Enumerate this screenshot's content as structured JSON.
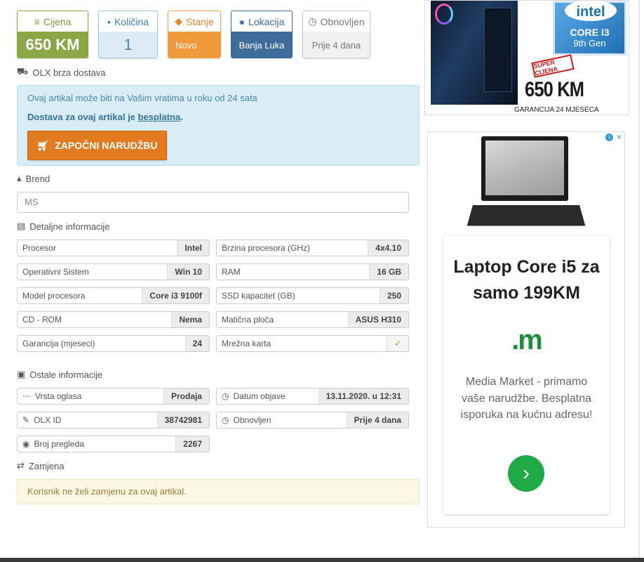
{
  "stats": {
    "price": {
      "label": "Cijena",
      "value": "650 KM"
    },
    "quantity": {
      "label": "Količina",
      "value": "1"
    },
    "condition": {
      "label": "Stanje",
      "value": "Novo"
    },
    "location": {
      "label": "Lokacija",
      "value": "Banja Luka"
    },
    "updated": {
      "label": "Obnovljen",
      "value": "Prije 4 dana"
    }
  },
  "delivery": {
    "title": "OLX brza dostava",
    "line1": "Ovaj artikal može biti na Vašim vratima u roku od 24 sata",
    "line2_prefix": "Dostava za ovaj artikal je ",
    "line2_link": "besplatna",
    "line2_suffix": ".",
    "button_label": "ZAPOČNI NARUDŽBU"
  },
  "brand": {
    "title": "Brend",
    "value": "MS"
  },
  "details": {
    "title": "Detaljne informacije",
    "items": [
      {
        "key": "Procesor",
        "value": "Intel"
      },
      {
        "key": "Brzina procesora (GHz)",
        "value": "4x4.10"
      },
      {
        "key": "Operativni Sistem",
        "value": "Win 10"
      },
      {
        "key": "RAM",
        "value": "16 GB"
      },
      {
        "key": "Model procesora",
        "value": "Core i3 9100f"
      },
      {
        "key": "SSD kapacitet (GB)",
        "value": "250"
      },
      {
        "key": "CD - ROM",
        "value": "Nema"
      },
      {
        "key": "Matična ploča",
        "value": "ASUS H310"
      },
      {
        "key": "Garancija (mjeseci)",
        "value": "24"
      },
      {
        "key": "Mrežna karta",
        "value": "✓"
      }
    ]
  },
  "other": {
    "title": "Ostale informacije",
    "items": [
      {
        "key": "Vrsta oglasa",
        "value": "Prodaja"
      },
      {
        "key": "Datum objave",
        "value": "13.11.2020. u 12:31"
      },
      {
        "key": "OLX ID",
        "value": "38742981"
      },
      {
        "key": "Obnovljen",
        "value": "Prije 4 dana"
      },
      {
        "key": "Broj pregleda",
        "value": "2267"
      }
    ]
  },
  "exchange": {
    "title": "Zamjena",
    "text": "Korisnik ne želi zamjenu za ovaj artikal."
  },
  "ad1": {
    "intel": "intel",
    "core": "CORE i3",
    "gen": "9th Gen",
    "badge": "SUPER CIJENA",
    "price": "650 KM",
    "warranty": "GARANCIJA 24 MJESECA"
  },
  "ad2": {
    "headline": "Laptop Core i5 za samo 199KM",
    "logo": ".m",
    "description": "Media Market - primamo vaše narudžbe. Besplatna isporuka na kućnu adresu!",
    "arrow": "›"
  },
  "colors": {
    "price": "#8aa645",
    "quantity": "#dcebf6",
    "condition": "#f0993a",
    "location": "#3d6b9a",
    "order_button": "#e27b1f",
    "ad_go": "#1faa46"
  }
}
